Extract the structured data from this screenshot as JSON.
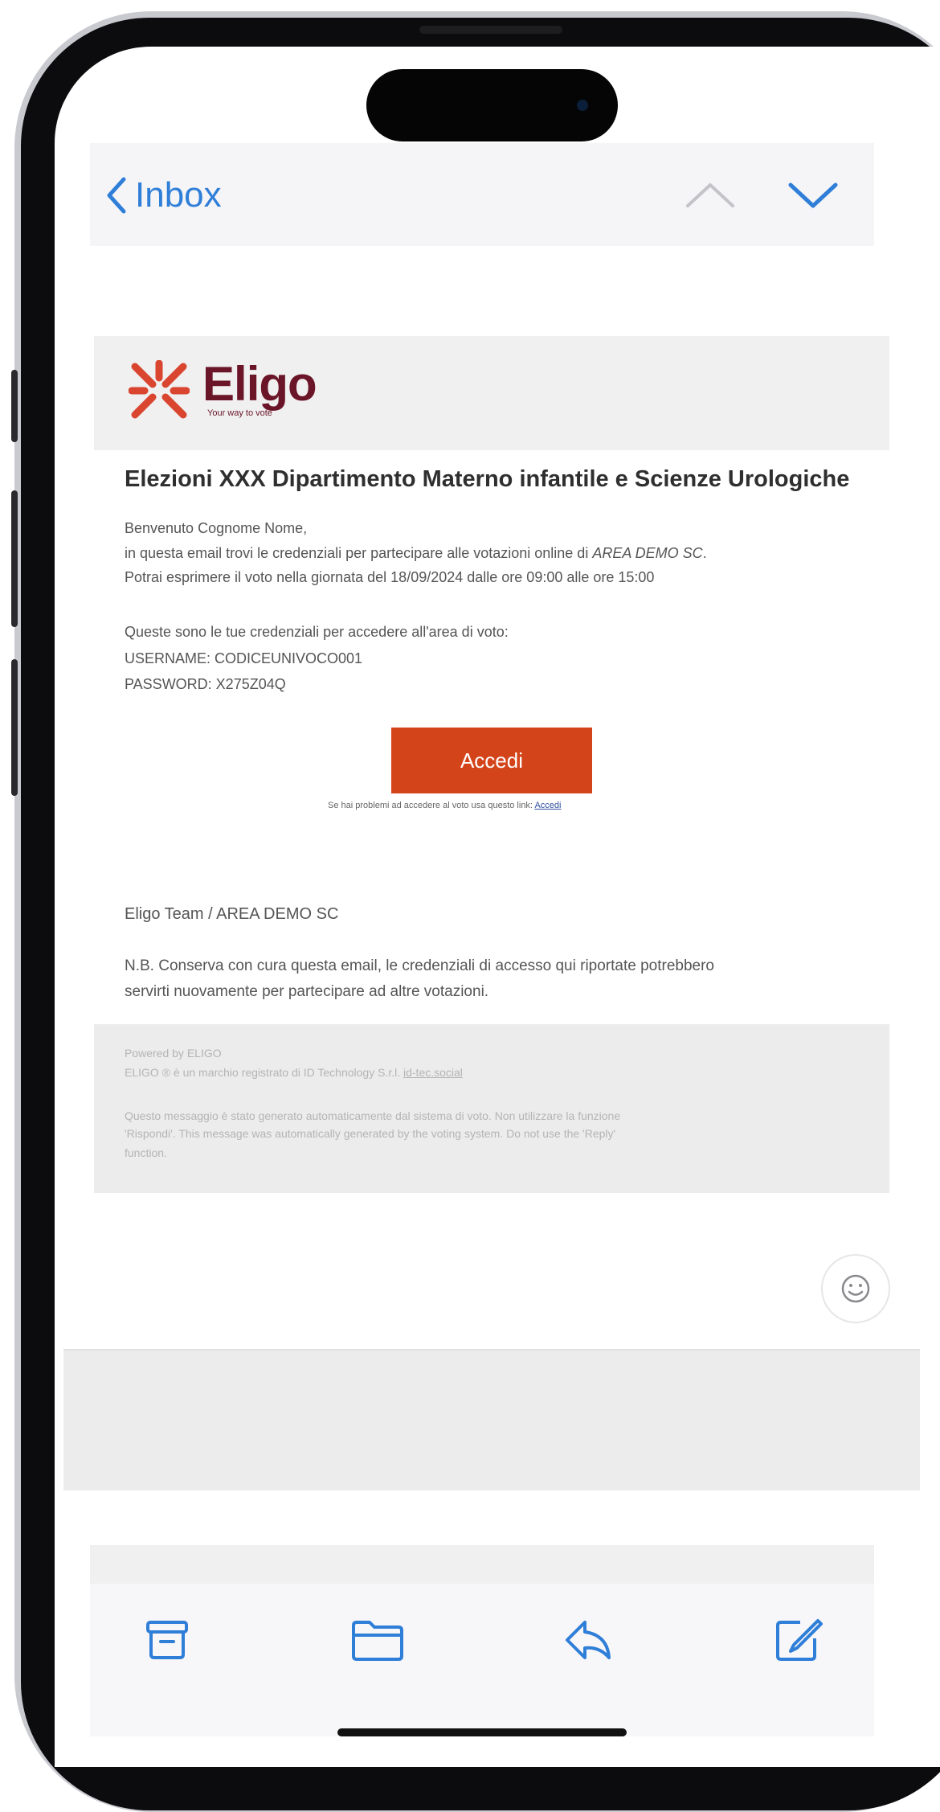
{
  "nav": {
    "back_label": "Inbox",
    "accent_color": "#2f7ed8"
  },
  "brand": {
    "name": "Eligo",
    "tagline": "Your way to vote",
    "color": "#6a1528",
    "logo_color": "#d9452f"
  },
  "email": {
    "title": "Elezioni XXX Dipartimento Materno infantile e Scienze Urologiche",
    "greeting": "Benvenuto Cognome Nome,",
    "line2_pre": "in questa email trovi le credenziali per partecipare alle votazioni online di ",
    "line2_org": "AREA DEMO SC",
    "line2_post": ".",
    "line3": "Potrai esprimere il voto nella giornata del 18/09/2024 dalle ore 09:00 alle ore 15:00",
    "creds_intro": "Queste sono le tue credenziali per accedere all'area di voto:",
    "username": "USERNAME: CODICEUNIVOCO001",
    "password": "PASSWORD: X275Z04Q",
    "button_label": "Accedi",
    "button_color": "#d4441a",
    "trouble_text": "Se hai problemi ad accedere al voto usa questo link: ",
    "trouble_link": "Accedi",
    "signature": "Eligo Team / AREA DEMO SC",
    "nb_line1": "N.B. Conserva con cura questa email, le credenziali di accesso qui riportate potrebbero",
    "nb_line2": "servirti nuovamente per partecipare ad altre votazioni."
  },
  "footer": {
    "powered": "Powered by ELIGO",
    "trademark_pre": "ELIGO ® è un marchio registrato di ID Technology S.r.l. ",
    "trademark_link": "id-tec.social",
    "disclaimer1": "Questo messaggio è stato generato automaticamente dal sistema di voto. Non utilizzare la funzione",
    "disclaimer2": "'Rispondi'. This message was automatically generated by the voting system. Do not use the 'Reply'",
    "disclaimer3": "function."
  },
  "toolbar": {
    "icons": [
      "archive-icon",
      "folder-icon",
      "reply-icon",
      "compose-icon"
    ]
  }
}
